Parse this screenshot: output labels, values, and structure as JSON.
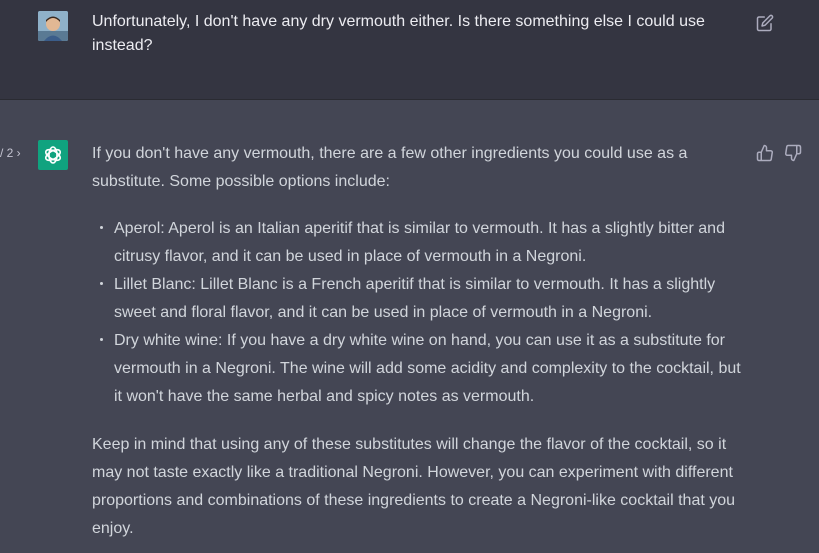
{
  "user_message": {
    "text": "Unfortunately, I don't have any dry vermouth either. Is there something else I could use instead?",
    "edit_icon": "edit-icon"
  },
  "assistant_message": {
    "pager": "/ 2 ›",
    "intro": "If you don't have any vermouth, there are a few other ingredients you could use as a substitute. Some possible options include:",
    "items": [
      "Aperol: Aperol is an Italian aperitif that is similar to vermouth. It has a slightly bitter and citrusy flavor, and it can be used in place of vermouth in a Negroni.",
      "Lillet Blanc: Lillet Blanc is a French aperitif that is similar to vermouth. It has a slightly sweet and floral flavor, and it can be used in place of vermouth in a Negroni.",
      "Dry white wine: If you have a dry white wine on hand, you can use it as a substitute for vermouth in a Negroni. The wine will add some acidity and complexity to the cocktail, but it won't have the same herbal and spicy notes as vermouth."
    ],
    "outro": "Keep in mind that using any of these substitutes will change the flavor of the cocktail, so it may not taste exactly like a traditional Negroni. However, you can experiment with different proportions and combinations of these ingredients to create a Negroni-like cocktail that you enjoy.",
    "icons": [
      "thumbs-up-icon",
      "thumbs-down-icon"
    ]
  },
  "colors": {
    "user_bg": "#343541",
    "assistant_bg": "#444654",
    "brand": "#10a37f",
    "text": "#d1d5db"
  }
}
